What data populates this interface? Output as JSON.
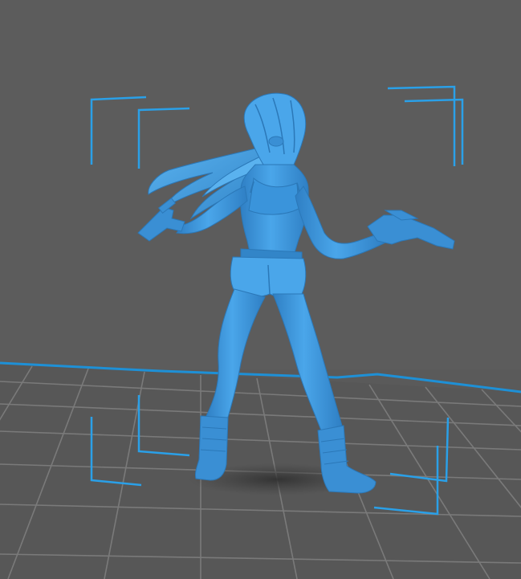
{
  "viewport": {
    "background_color": "#5a5a5a",
    "floor_color": "#5a5a5a",
    "grid_line_color": "#7d7d7d",
    "horizon_line_color": "#1e90d6"
  },
  "model": {
    "subject": "figure-model",
    "fill_color": "#3f9be3",
    "highlight_color": "#6bb8f0",
    "shadow_color": "#2a6fa8"
  },
  "selection": {
    "bracket_color": "#2aa0e8"
  },
  "floor_shadow": {
    "color": "#3c3c3c"
  }
}
